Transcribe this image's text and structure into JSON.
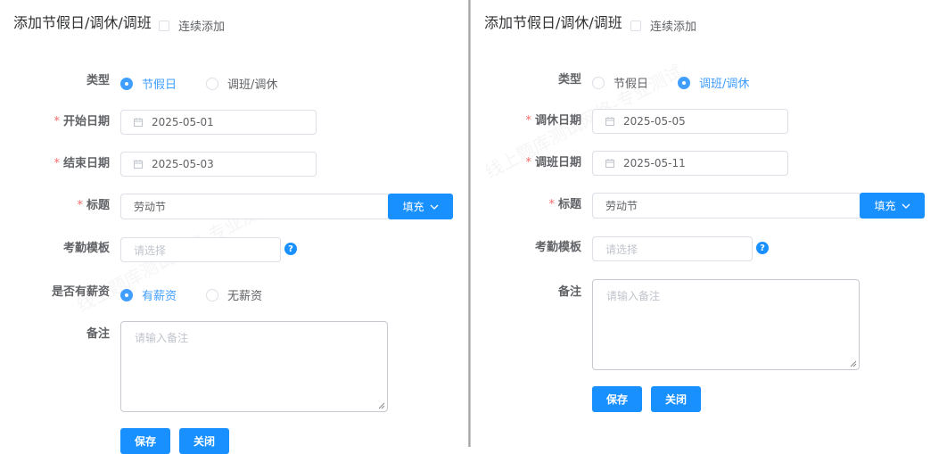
{
  "watermark": "线上题库测试网络-专业测试",
  "left": {
    "title": "添加节假日/调休/调班",
    "continuous_label": "连续添加",
    "type_label": "类型",
    "type_options": [
      "节假日",
      "调班/调休"
    ],
    "start_label": "开始日期",
    "start_value": "2025-05-01",
    "end_label": "结束日期",
    "end_value": "2025-05-03",
    "subject_label": "标题",
    "subject_value": "劳动节",
    "fill_label": "填充",
    "template_label": "考勤模板",
    "template_placeholder": "请选择",
    "paid_label": "是否有薪资",
    "paid_options": [
      "有薪资",
      "无薪资"
    ],
    "remark_label": "备注",
    "remark_placeholder": "请输入备注",
    "save_label": "保存",
    "close_label": "关闭"
  },
  "right": {
    "title": "添加节假日/调休/调班",
    "continuous_label": "连续添加",
    "type_label": "类型",
    "type_options": [
      "节假日",
      "调班/调休"
    ],
    "rest_label": "调休日期",
    "rest_value": "2025-05-05",
    "work_label": "调班日期",
    "work_value": "2025-05-11",
    "subject_label": "标题",
    "subject_value": "劳动节",
    "fill_label": "填充",
    "template_label": "考勤模板",
    "template_placeholder": "请选择",
    "remark_label": "备注",
    "remark_placeholder": "请输入备注",
    "save_label": "保存",
    "close_label": "关闭"
  },
  "colors": {
    "primary": "#1890ff",
    "radio_checked": "#409eff",
    "required": "#f56c6c",
    "border": "#dcdfe6"
  },
  "icons": [
    "calendar-icon",
    "chevron-down-icon",
    "help-icon",
    "resize-handle-icon"
  ]
}
